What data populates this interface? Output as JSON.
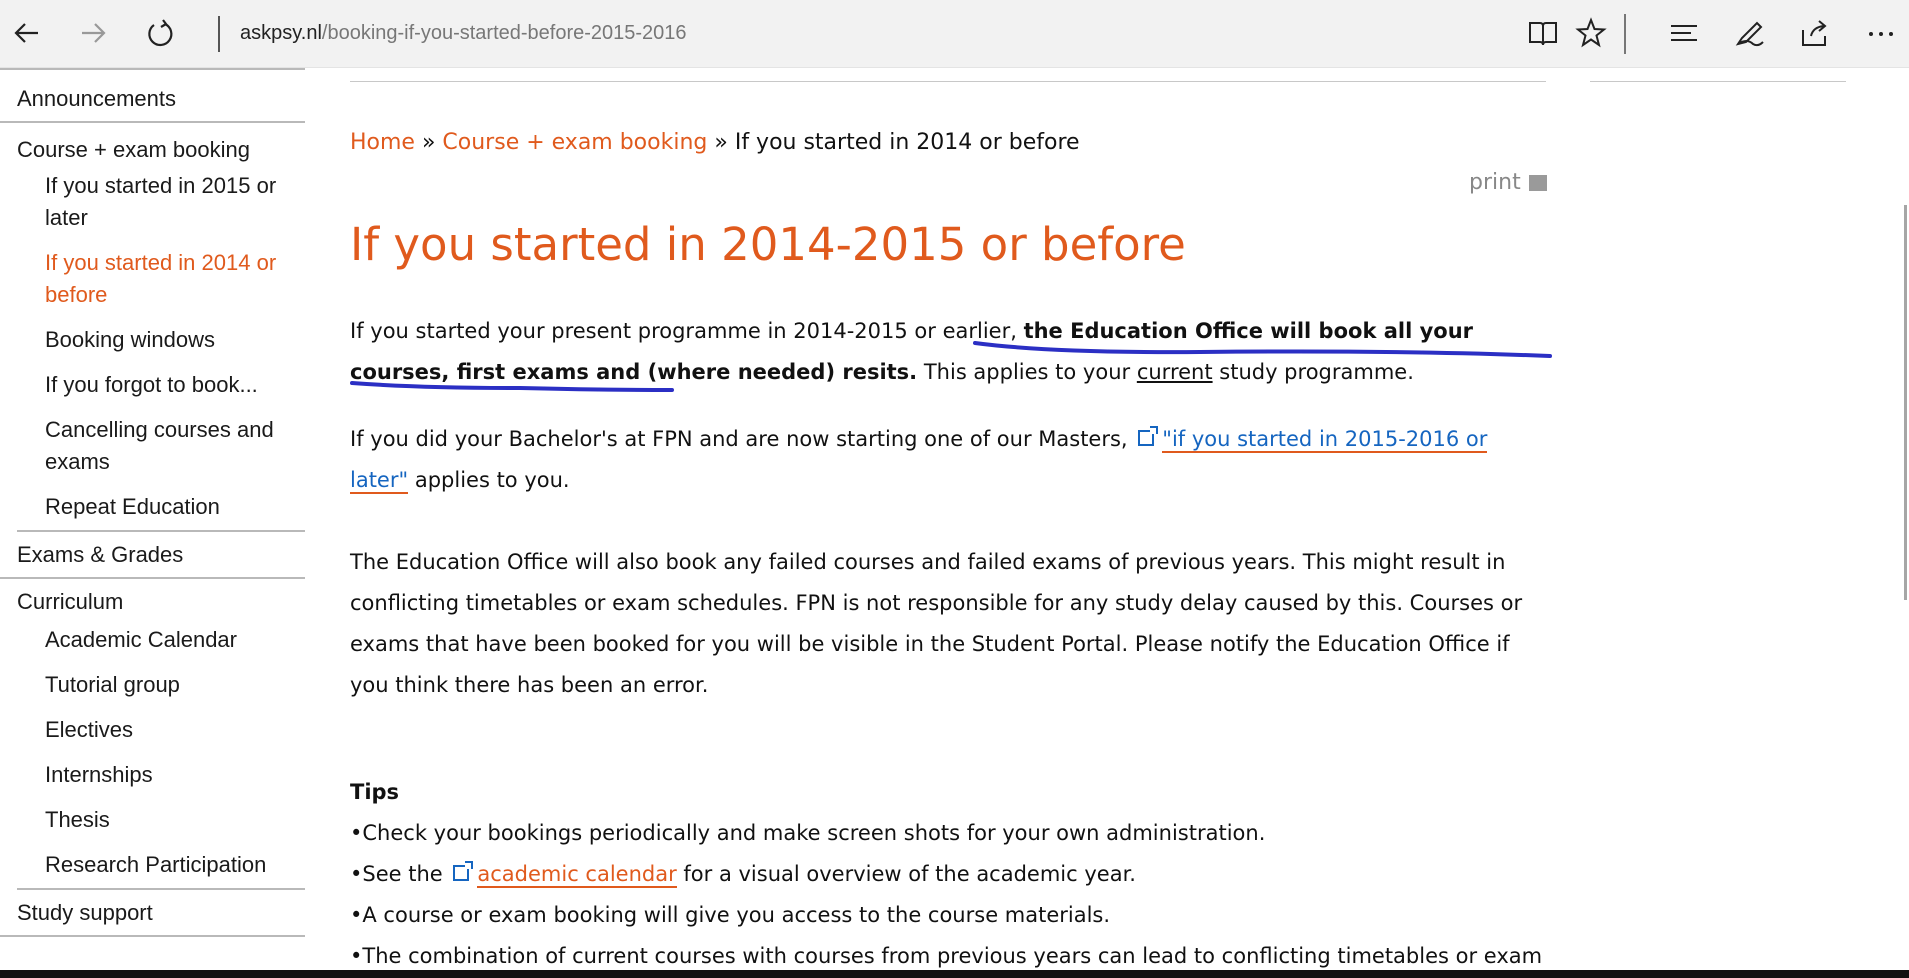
{
  "browser": {
    "url_domain": "askpsy.nl",
    "url_path": "/booking-if-you-started-before-2015-2016"
  },
  "sidebar": {
    "items": [
      {
        "label": "Announcements",
        "level": "top"
      },
      {
        "label": "Course + exam booking",
        "level": "top"
      },
      {
        "label": "If you started in 2015 or later",
        "level": "sub"
      },
      {
        "label": "If you started in 2014 or before",
        "level": "sub",
        "active": true
      },
      {
        "label": "Booking windows",
        "level": "sub"
      },
      {
        "label": "If you forgot to book...",
        "level": "sub"
      },
      {
        "label": "Cancelling courses and exams",
        "level": "sub"
      },
      {
        "label": "Repeat Education",
        "level": "sub"
      },
      {
        "label": "Exams & Grades",
        "level": "top"
      },
      {
        "label": "Curriculum",
        "level": "top"
      },
      {
        "label": "Academic Calendar",
        "level": "sub"
      },
      {
        "label": "Tutorial group",
        "level": "sub"
      },
      {
        "label": "Electives",
        "level": "sub"
      },
      {
        "label": "Internships",
        "level": "sub"
      },
      {
        "label": "Thesis",
        "level": "sub"
      },
      {
        "label": "Research Participation",
        "level": "sub"
      },
      {
        "label": "Study support",
        "level": "top"
      }
    ]
  },
  "breadcrumb": {
    "home": "Home",
    "sep": " » ",
    "parent": "Course + exam booking",
    "current": "If you started in 2014 or before"
  },
  "print_label": "print",
  "title": "If you started in 2014-2015 or before",
  "p1": {
    "pre": "If you started your present programme in 2014-2015 or earlier, ",
    "bold": "the Education Office will book all your courses, first exams and (where needed) resits.",
    "mid": " This applies to your ",
    "underlined": "current",
    "post": " study programme."
  },
  "p2": {
    "pre": " If you did your Bachelor's at FPN and are now starting one of our Masters, ",
    "link": "\"if you started in 2015-2016 or later\"",
    "post": " applies to you."
  },
  "p3": "The Education Office will also book any failed courses and failed exams of previous years. This might result in conflicting timetables or exam schedules.  FPN is not responsible for any study delay caused by this. Courses or exams that have been booked for you will be visible in the Student Portal. Please notify the Education Office if you think there has been an error.",
  "tips": {
    "title": "Tips",
    "t1": "•Check your bookings periodically and make screen shots for your own administration.",
    "t2_pre": "•See the ",
    "t2_link": "academic calendar",
    "t2_post": " for a visual overview of the academic year.",
    "t3": "•A course or exam booking will give you access to the course materials.",
    "t4": "•The combination of current courses with courses from previous years can lead to conflicting timetables or exam"
  },
  "colors": {
    "accent": "#e05a1d",
    "link": "#1565c0",
    "annotation": "#2b2fc4"
  }
}
